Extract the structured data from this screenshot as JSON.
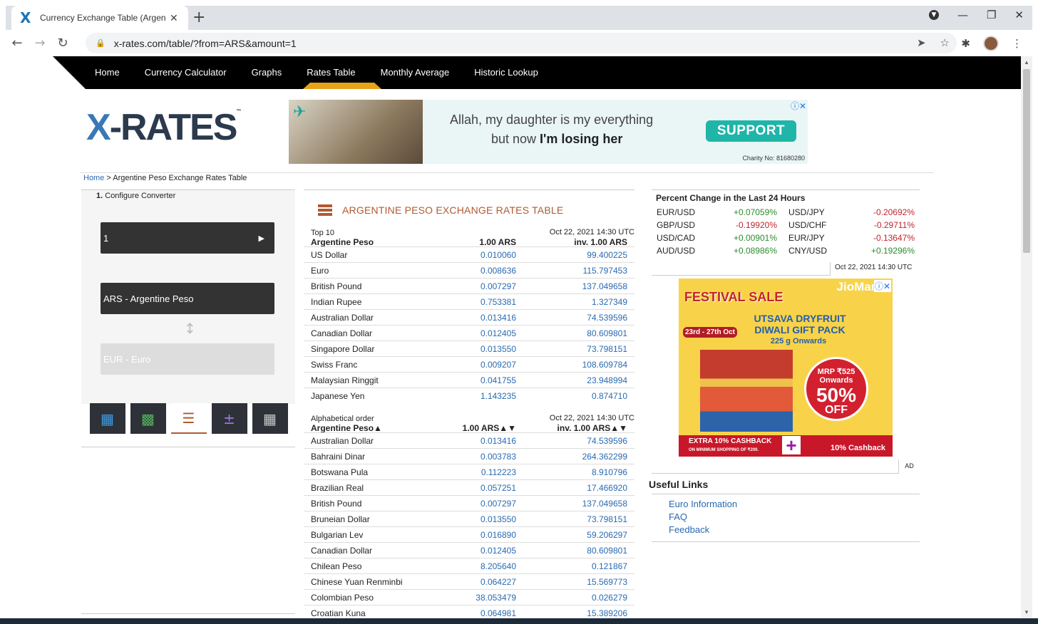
{
  "browser": {
    "tab_title": "Currency Exchange Table (Argentine Peso - ARS) - X-Rates",
    "url": "x-rates.com/table/?from=ARS&amount=1"
  },
  "nav": {
    "items": [
      "Home",
      "Currency Calculator",
      "Graphs",
      "Rates Table",
      "Monthly Average",
      "Historic Lookup"
    ],
    "active": "Rates Table"
  },
  "logo": {
    "text_x": "X",
    "text_rest": "-RATES",
    "tm": "™"
  },
  "ad_banner": {
    "line1": "Allah, my daughter is my everything",
    "line2_prefix": "but now ",
    "line2_bold": "I'm losing her",
    "cta": "SUPPORT",
    "charity": "Charity No: 81680280"
  },
  "breadcrumb": {
    "home": "Home",
    "current": " > Argentine Peso Exchange Rates Table"
  },
  "converter": {
    "step_num": "1.",
    "step_label": " Configure Converter",
    "amount": "1",
    "from": "ARS - Argentine Peso",
    "to": "EUR - Euro"
  },
  "table": {
    "title": "ARGENTINE PESO EXCHANGE RATES TABLE",
    "top10": {
      "sub": "Top 10",
      "date": "Oct 22, 2021 14:30 UTC",
      "h1": "Argentine Peso",
      "h2": "1.00 ARS",
      "h3": "inv. 1.00 ARS",
      "rows": [
        [
          "US Dollar",
          "0.010060",
          "99.400225"
        ],
        [
          "Euro",
          "0.008636",
          "115.797453"
        ],
        [
          "British Pound",
          "0.007297",
          "137.049658"
        ],
        [
          "Indian Rupee",
          "0.753381",
          "1.327349"
        ],
        [
          "Australian Dollar",
          "0.013416",
          "74.539596"
        ],
        [
          "Canadian Dollar",
          "0.012405",
          "80.609801"
        ],
        [
          "Singapore Dollar",
          "0.013550",
          "73.798151"
        ],
        [
          "Swiss Franc",
          "0.009207",
          "108.609784"
        ],
        [
          "Malaysian Ringgit",
          "0.041755",
          "23.948994"
        ],
        [
          "Japanese Yen",
          "1.143235",
          "0.874710"
        ]
      ]
    },
    "alpha": {
      "sub": "Alphabetical order",
      "date": "Oct 22, 2021 14:30 UTC",
      "h1": "Argentine Peso▲",
      "h2": "1.00 ARS▲▼",
      "h3": "inv. 1.00 ARS▲▼",
      "rows": [
        [
          "Australian Dollar",
          "0.013416",
          "74.539596"
        ],
        [
          "Bahraini Dinar",
          "0.003783",
          "264.362299"
        ],
        [
          "Botswana Pula",
          "0.112223",
          "8.910796"
        ],
        [
          "Brazilian Real",
          "0.057251",
          "17.466920"
        ],
        [
          "British Pound",
          "0.007297",
          "137.049658"
        ],
        [
          "Bruneian Dollar",
          "0.013550",
          "73.798151"
        ],
        [
          "Bulgarian Lev",
          "0.016890",
          "59.206297"
        ],
        [
          "Canadian Dollar",
          "0.012405",
          "80.609801"
        ],
        [
          "Chilean Peso",
          "8.205640",
          "0.121867"
        ],
        [
          "Chinese Yuan Renminbi",
          "0.064227",
          "15.569773"
        ],
        [
          "Colombian Peso",
          "38.053479",
          "0.026279"
        ],
        [
          "Croatian Kuna",
          "0.064981",
          "15.389206"
        ]
      ]
    }
  },
  "pct_change": {
    "title": "Percent Change in the Last 24 Hours",
    "rows": [
      [
        "EUR/USD",
        "+0.07059%",
        "pos",
        "USD/JPY",
        "-0.20692%",
        "neg"
      ],
      [
        "GBP/USD",
        "-0.19920%",
        "neg",
        "USD/CHF",
        "-0.29711%",
        "neg"
      ],
      [
        "USD/CAD",
        "+0.00901%",
        "pos",
        "EUR/JPY",
        "-0.13647%",
        "neg"
      ],
      [
        "AUD/USD",
        "+0.08986%",
        "pos",
        "CNY/USD",
        "+0.19296%",
        "pos"
      ]
    ],
    "date": "Oct 22, 2021 14:30 UTC"
  },
  "ad_side": {
    "brand": "JioMart",
    "fest": "FESTIVAL SALE",
    "dates": "23rd - 27th Oct",
    "headline": "UTSAVA DRYFRUIT DIWALI GIFT PACK",
    "grams": "225 g Onwards",
    "mrp": "MRP ₹525 Onwards",
    "pct": "50%",
    "off": "OFF",
    "cash_left": "EXTRA 10% CASHBACK",
    "cash_left_sub": "ON MINIMUM SHOPPING OF ₹200.",
    "cash_right": "10% Cashback",
    "tag": "AD"
  },
  "useful": {
    "title": "Useful Links",
    "links": [
      "Euro Information",
      "FAQ",
      "Feedback"
    ]
  }
}
